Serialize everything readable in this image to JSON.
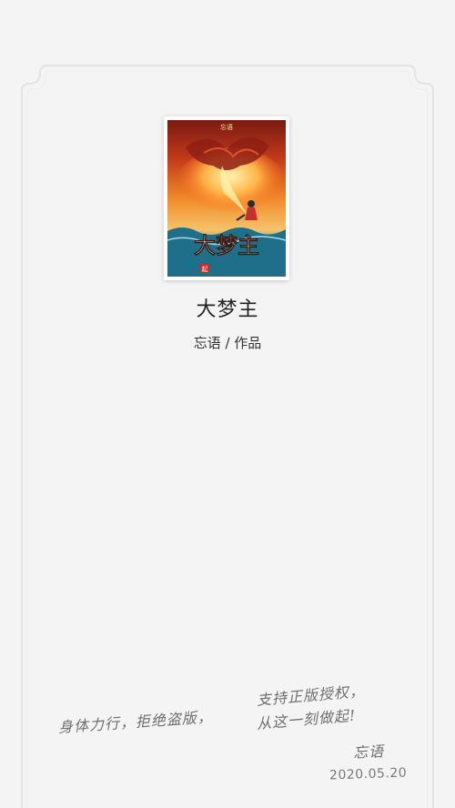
{
  "book": {
    "title": "大梦主",
    "author_line": "忘语 / 作品"
  },
  "cover": {
    "top_text": "忘语",
    "title_art": "大梦主",
    "badge": "起"
  },
  "slogan": {
    "part1": "身体力行，拒绝盗版，",
    "part2": "支持正版授权，",
    "part3": "从这一刻做起!",
    "signature": "忘语",
    "date": "2020.05.20"
  },
  "colors": {
    "background": "#f4f4f5",
    "frame_line": "#e6e6e8",
    "title_text": "#222222",
    "handwriting": "#6e6e6e"
  }
}
